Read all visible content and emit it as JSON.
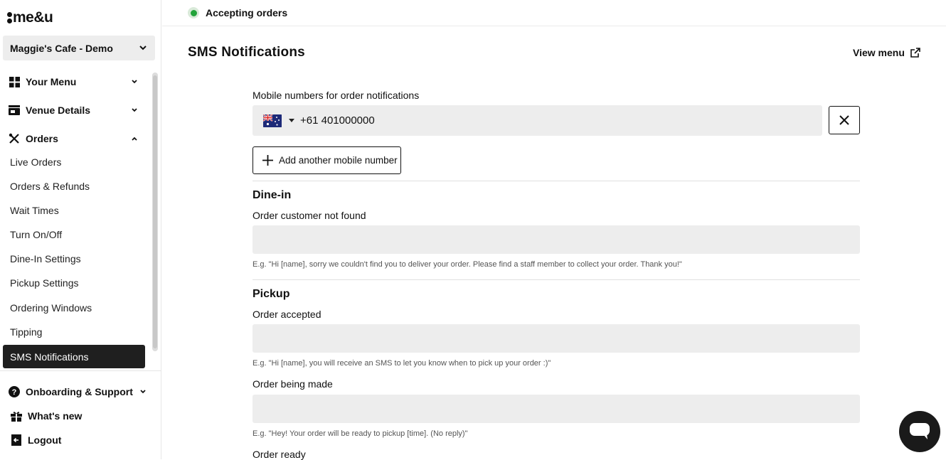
{
  "brand": {
    "logo_text": "me&u"
  },
  "venue": {
    "selected": "Maggie's Cafe - Demo"
  },
  "sidebar": {
    "groups": [
      {
        "label": "Your Menu",
        "icon": "grid-icon",
        "expanded": false
      },
      {
        "label": "Venue Details",
        "icon": "store-icon",
        "expanded": false
      },
      {
        "label": "Orders",
        "icon": "utensils-icon",
        "expanded": true
      }
    ],
    "order_items": [
      {
        "label": "Live Orders"
      },
      {
        "label": "Orders & Refunds"
      },
      {
        "label": "Wait Times"
      },
      {
        "label": "Turn On/Off"
      },
      {
        "label": "Dine-In Settings"
      },
      {
        "label": "Pickup Settings"
      },
      {
        "label": "Ordering Windows"
      },
      {
        "label": "Tipping"
      },
      {
        "label": "SMS Notifications",
        "active": true
      }
    ],
    "bottom": [
      {
        "label": "Onboarding & Support",
        "icon": "help-icon"
      },
      {
        "label": "What's new",
        "icon": "gift-icon"
      },
      {
        "label": "Logout",
        "icon": "logout-icon"
      }
    ]
  },
  "topbar": {
    "status_text": "Accepting orders",
    "status_color": "#22a33a"
  },
  "page": {
    "title": "SMS Notifications",
    "view_menu": "View menu"
  },
  "form": {
    "mobile_label": "Mobile numbers for order notifications",
    "phone_value": "+61 401000000",
    "country_flag": "australia-flag",
    "add_button": "Add another mobile number",
    "dine_in": {
      "title": "Dine-in",
      "customer_not_found": {
        "label": "Order customer not found",
        "value": "",
        "hint": "E.g. \"Hi [name], sorry we couldn't find you to deliver your order. Please find a staff member to collect your order. Thank you!\""
      }
    },
    "pickup": {
      "title": "Pickup",
      "order_accepted": {
        "label": "Order accepted",
        "value": "",
        "hint": "E.g. \"Hi [name], you will receive an SMS to let you know when to pick up your order :)\""
      },
      "order_being_made": {
        "label": "Order being made",
        "value": "",
        "hint": "E.g. \"Hey! Your order will be ready to pickup [time]. (No reply)\""
      },
      "order_ready": {
        "label": "Order ready"
      }
    }
  }
}
